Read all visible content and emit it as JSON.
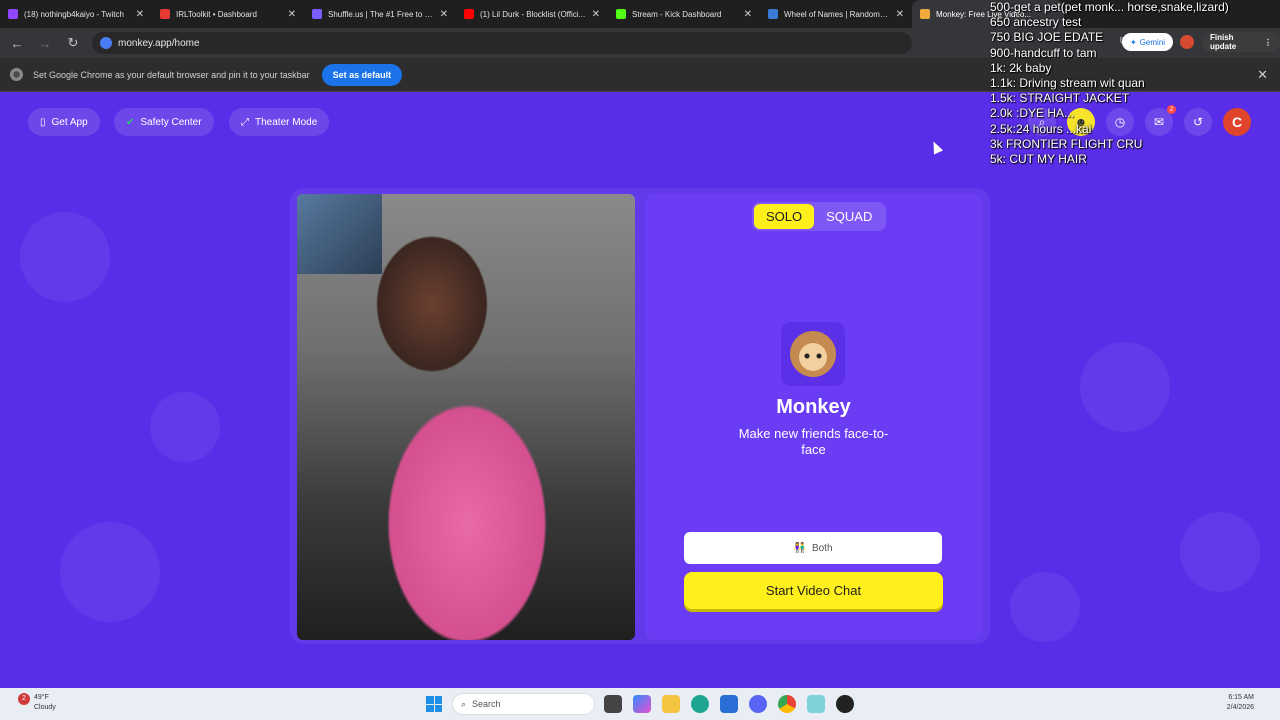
{
  "browser": {
    "tabs": [
      {
        "title": "(18) nothingb4kaiyo - Twitch",
        "color": "#9146ff"
      },
      {
        "title": "IRLToolkit • Dashboard",
        "color": "#e53935"
      },
      {
        "title": "Shuffle.us | The #1 Free to Pl...",
        "color": "#7b5cff"
      },
      {
        "title": "(1) Lil Durk - Blocklist (Offici...",
        "color": "#ff0000"
      },
      {
        "title": "Stream - Kick Dashboard",
        "color": "#53fc18"
      },
      {
        "title": "Wheel of Names | Random n...",
        "color": "#3a7bd5"
      },
      {
        "title": "Monkey: Free Live Video...",
        "color": "#f2a93b",
        "active": true
      }
    ],
    "url": "monkey.app/home",
    "gemini_label": "Gemini",
    "finish_update_label": "Finish update",
    "infobar_text": "Set Google Chrome as your default browser and pin it to your taskbar",
    "set_default_label": "Set as default"
  },
  "page": {
    "top_pills": [
      {
        "label": "Get App",
        "icon": "phone-icon"
      },
      {
        "label": "Safety Center",
        "icon": "shield-check-icon"
      },
      {
        "label": "Theater Mode",
        "icon": "expand-icon"
      }
    ],
    "notification_count": "2",
    "avatar_letter": "C",
    "mode_solo": "SOLO",
    "mode_squad": "SQUAD",
    "app_title": "Monkey",
    "app_tagline": "Make new friends face-to-face",
    "gender_filter": "Both",
    "start_label": "Start Video Chat"
  },
  "overlay_lines": [
    "500-get a pet(pet monk... horse,snake,lizard)",
    "650 ancestry test",
    "750 BIG JOE EDATE",
    "900-handcuff to tam",
    "1k: 2k baby",
    "1.1k: Driving stream wit quan",
    "1.5k: STRAIGHT JACKET",
    "2.0k :DYE HA...",
    "2.5k:24 hours ...kai",
    "3k FRONTIER FLIGHT CRU",
    "5k: CUT MY HAIR"
  ],
  "taskbar": {
    "weather_badge": "2",
    "temperature": "49°F",
    "condition": "Cloudy",
    "search_placeholder": "Search",
    "time": "6:15 AM",
    "date": "2/4/2026"
  }
}
